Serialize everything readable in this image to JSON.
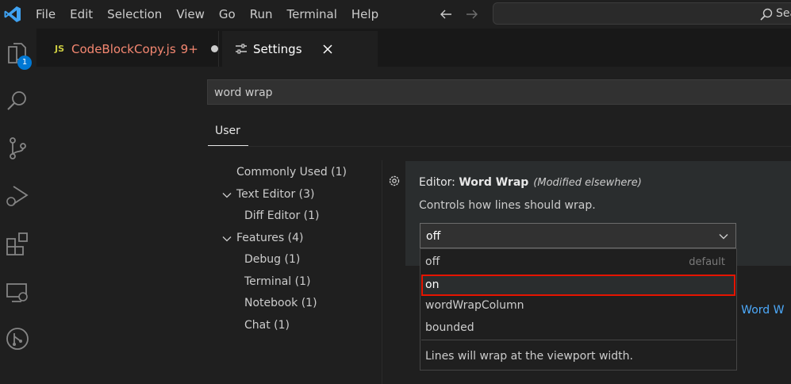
{
  "menu": [
    "File",
    "Edit",
    "Selection",
    "View",
    "Go",
    "Run",
    "Terminal",
    "Help"
  ],
  "search": {
    "text": "Sea"
  },
  "activity": {
    "explorer_badge": "1"
  },
  "tabs": {
    "file": {
      "icon_label": "JS",
      "name": "CodeBlockCopy.js",
      "problems": "9+"
    },
    "settings": {
      "name": "Settings"
    }
  },
  "settings": {
    "query": "word wrap",
    "scope_tab": "User",
    "toc": [
      "Commonly Used (1)",
      "Text Editor (3)",
      "Diff Editor (1)",
      "Features (4)",
      "Debug (1)",
      "Terminal (1)",
      "Notebook (1)",
      "Chat (1)"
    ],
    "word_wrap": {
      "category": "Editor: ",
      "name": "Word Wrap",
      "modified": "(Modified elsewhere)",
      "description": "Controls how lines should wrap.",
      "value": "off",
      "options": [
        "off",
        "on",
        "wordWrapColumn",
        "bounded"
      ],
      "default_hint": "default",
      "option_description": "Lines will wrap at the viewport width."
    },
    "partial_link": ": Word W"
  },
  "colors": {
    "accent": "#0078d4",
    "highlight_border": "#e51400",
    "link": "#4daafc"
  }
}
